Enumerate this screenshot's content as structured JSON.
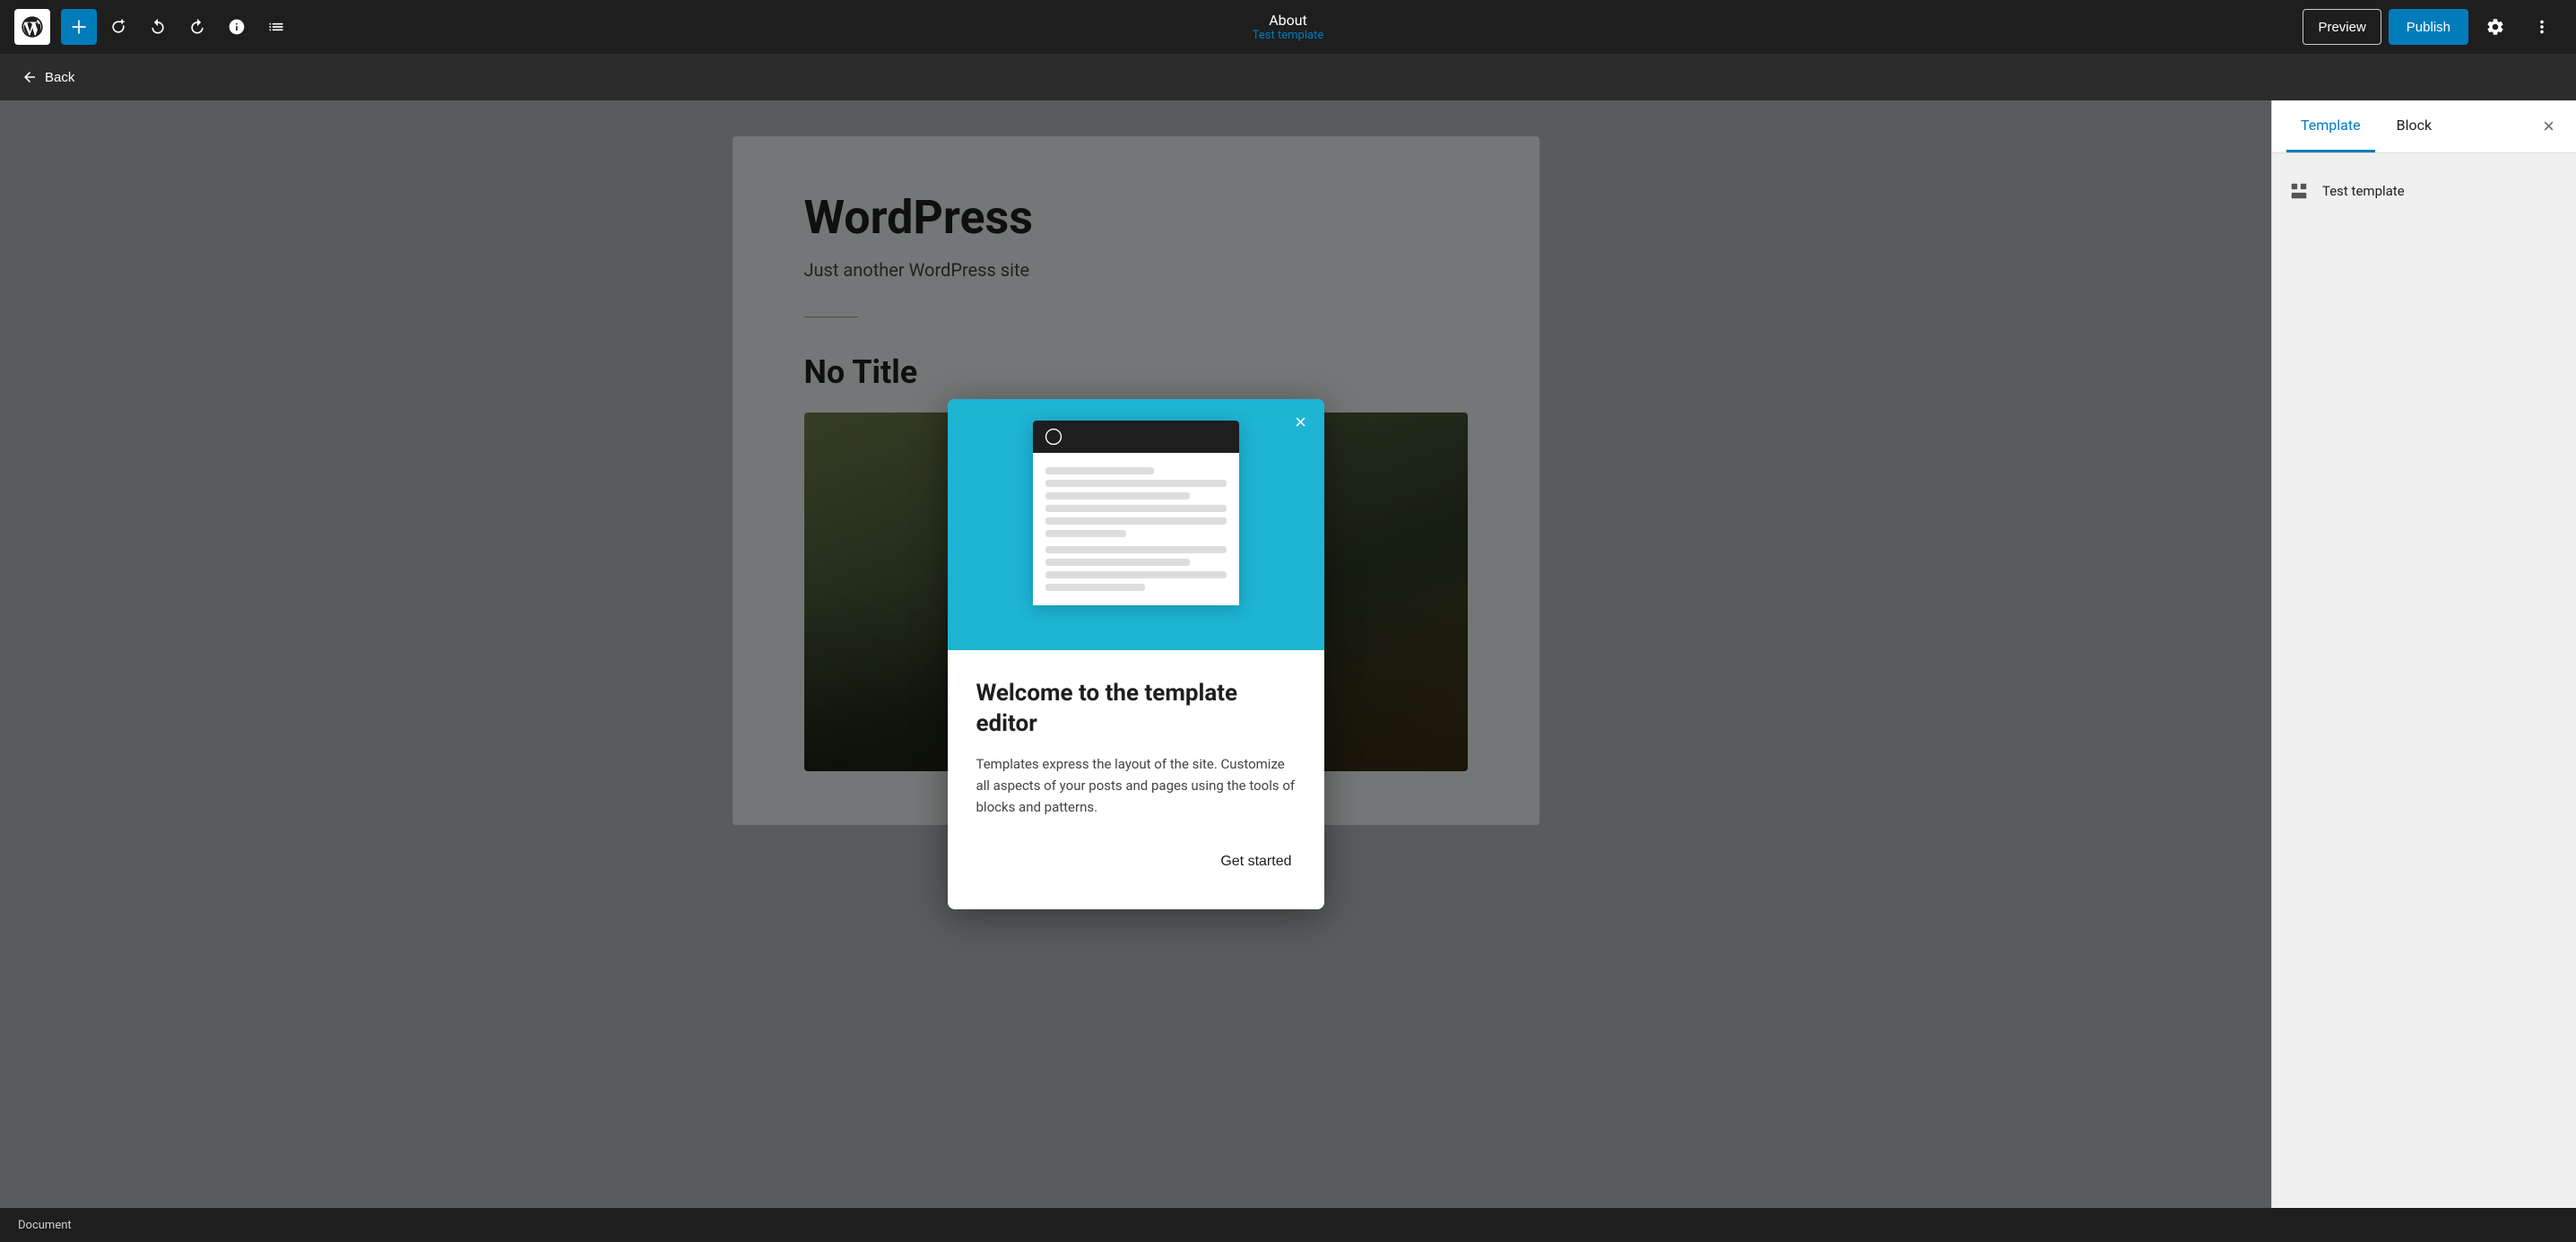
{
  "toolbar": {
    "page_title": "About",
    "page_subtitle": "Test template",
    "preview_label": "Preview",
    "publish_label": "Publish"
  },
  "secondary_bar": {
    "back_label": "Back"
  },
  "canvas": {
    "site_title": "WordPress",
    "tagline": "Just another WordPress site",
    "no_title": "No Title"
  },
  "right_panel": {
    "tab_template": "Template",
    "tab_block": "Block",
    "template_name": "Test template"
  },
  "status_bar": {
    "label": "Document"
  },
  "modal": {
    "close_label": "×",
    "title": "Welcome to the template editor",
    "description": "Templates express the layout of the site. Customize all aspects of your posts and pages using the tools of blocks and patterns.",
    "get_started_label": "Get started"
  }
}
